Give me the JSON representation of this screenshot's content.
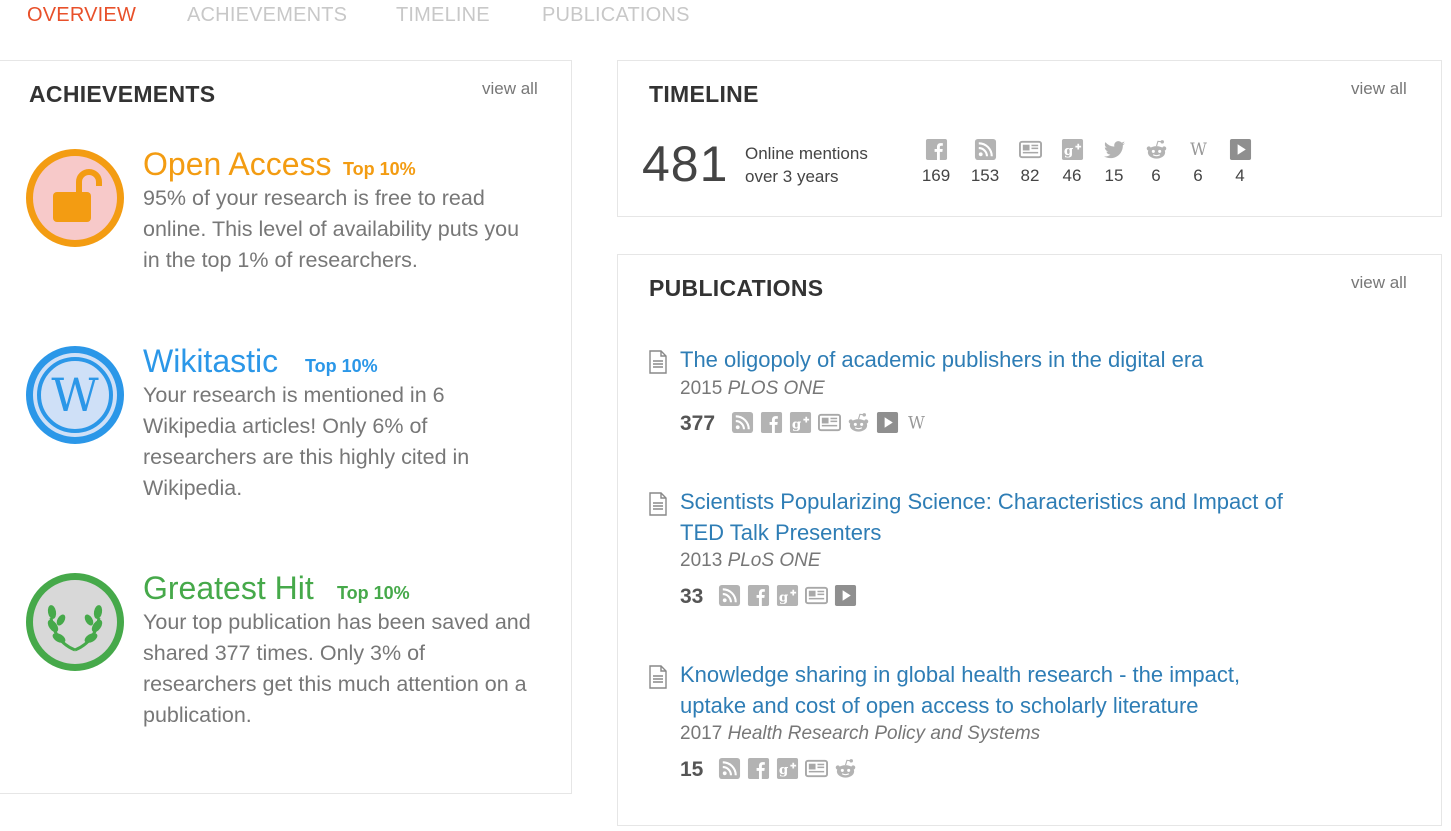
{
  "tabs": [
    {
      "label": "OVERVIEW",
      "active": true
    },
    {
      "label": "ACHIEVEMENTS",
      "active": false
    },
    {
      "label": "TIMELINE",
      "active": false
    },
    {
      "label": "PUBLICATIONS",
      "active": false
    }
  ],
  "achievements": {
    "title": "ACHIEVEMENTS",
    "view_all": "view all",
    "items": [
      {
        "title": "Open Access",
        "rank": "Top 10%",
        "color": "#f39c12",
        "icon": "unlock-icon",
        "description": "95% of your research is free to read online. This level of availability puts you in the top 1% of researchers."
      },
      {
        "title": "Wikitastic",
        "rank": "Top 10%",
        "color": "#2b97e8",
        "icon": "wikipedia-icon",
        "description": "Your research is mentioned in 6 Wikipedia articles! Only 6% of researchers are this highly cited in Wikipedia."
      },
      {
        "title": "Greatest Hit",
        "rank": "Top 10%",
        "color": "#46a94a",
        "icon": "laurel-icon",
        "description": "Your top publication has been saved and shared 377 times. Only 3% of researchers get this much attention on a publication."
      }
    ]
  },
  "timeline": {
    "title": "TIMELINE",
    "view_all": "view all",
    "total": "481",
    "label_line1": "Online mentions",
    "label_line2": "over 3 years",
    "sources": [
      {
        "icon": "facebook-icon",
        "count": "169"
      },
      {
        "icon": "rss-icon",
        "count": "153"
      },
      {
        "icon": "news-icon",
        "count": "82"
      },
      {
        "icon": "google-plus-icon",
        "count": "46"
      },
      {
        "icon": "twitter-icon",
        "count": "15"
      },
      {
        "icon": "reddit-icon",
        "count": "6"
      },
      {
        "icon": "wikipedia-icon",
        "count": "6"
      },
      {
        "icon": "video-icon",
        "count": "4"
      }
    ]
  },
  "publications": {
    "title": "PUBLICATIONS",
    "view_all": "view all",
    "items": [
      {
        "title": "The oligopoly of academic publishers in the digital era",
        "year": "2015",
        "journal": "PLOS ONE",
        "score": "377",
        "icons": [
          "rss-icon",
          "facebook-icon",
          "google-plus-icon",
          "news-icon",
          "reddit-icon",
          "video-icon",
          "wikipedia-icon"
        ]
      },
      {
        "title": "Scientists Popularizing Science: Characteristics and Impact of TED Talk Presenters",
        "year": "2013",
        "journal": "PLoS ONE",
        "score": "33",
        "icons": [
          "rss-icon",
          "facebook-icon",
          "google-plus-icon",
          "news-icon",
          "video-icon"
        ]
      },
      {
        "title": "Knowledge sharing in global health research - the impact, uptake and cost of open access to scholarly literature",
        "year": "2017",
        "journal": "Health Research Policy and Systems",
        "score": "15",
        "icons": [
          "rss-icon",
          "facebook-icon",
          "google-plus-icon",
          "news-icon",
          "reddit-icon"
        ]
      }
    ]
  },
  "colors": {
    "accent": "#e8502a",
    "link": "#2e7db5",
    "icon_gray": "#b3b3b3"
  }
}
